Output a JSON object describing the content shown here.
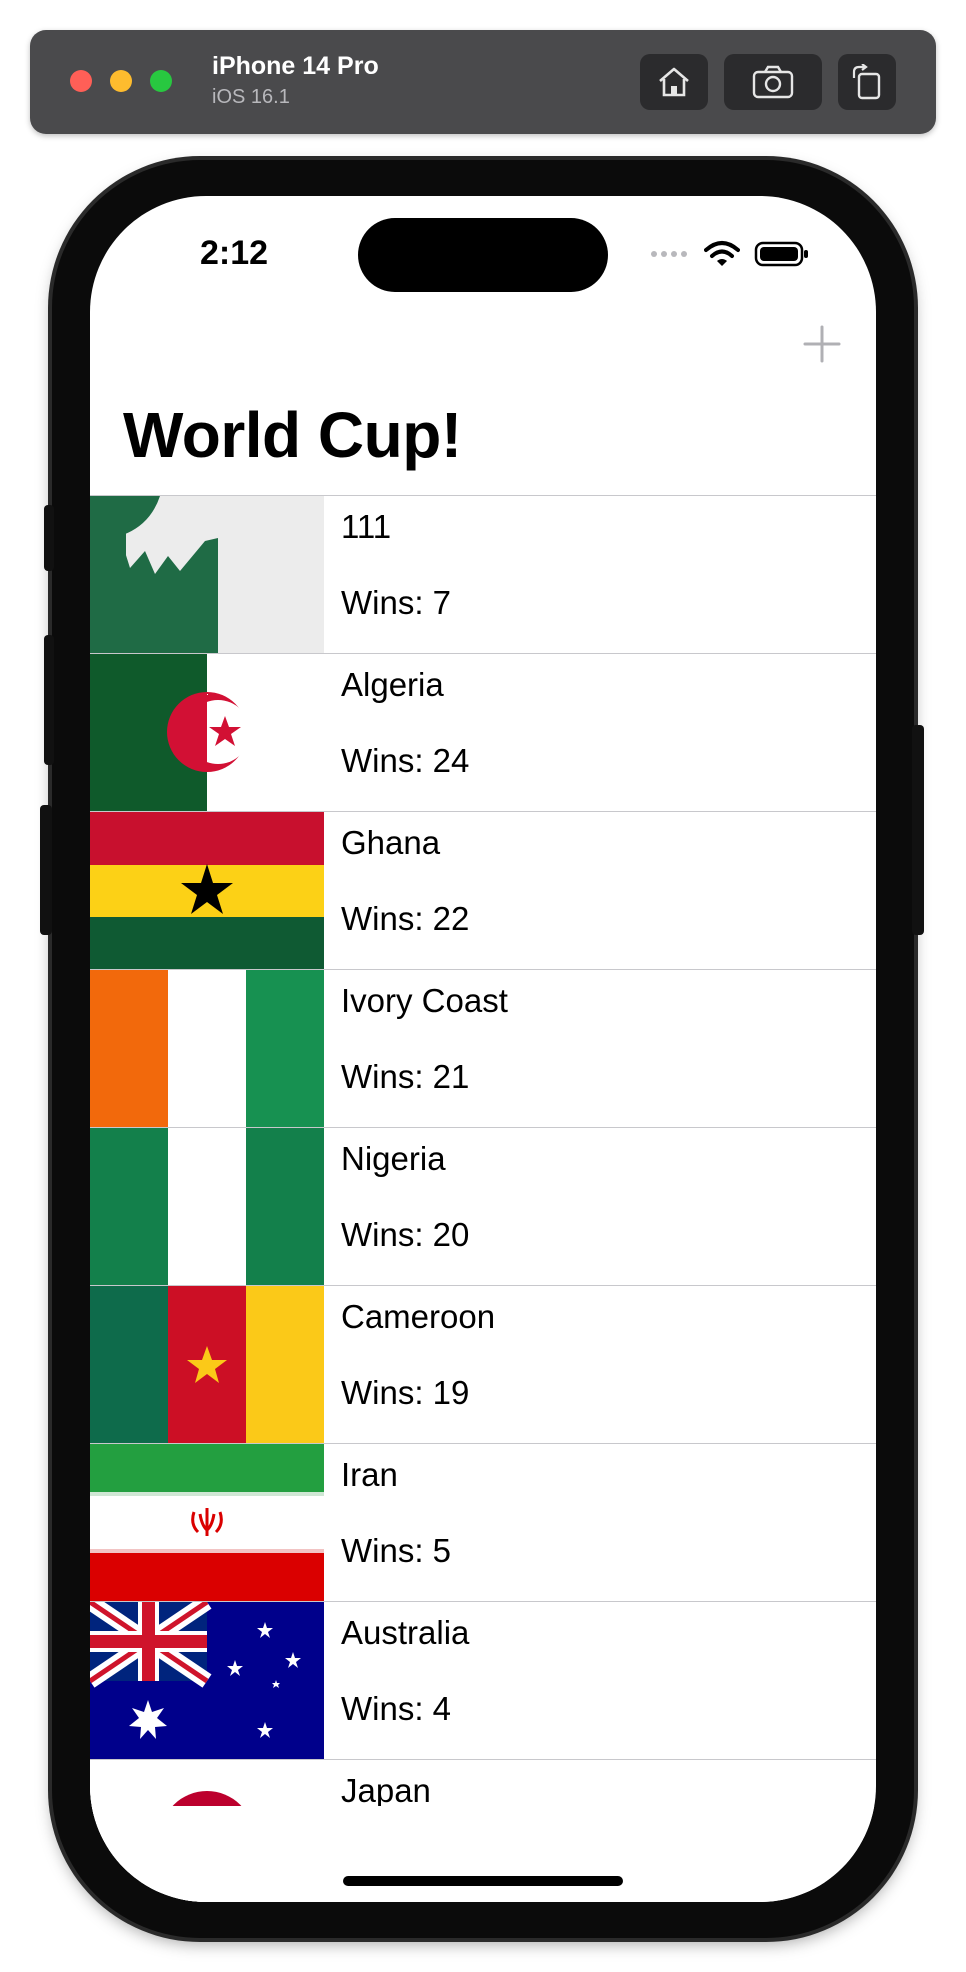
{
  "simulator": {
    "device_name": "iPhone 14 Pro",
    "os_version": "iOS 16.1",
    "icons": [
      "home-icon",
      "screenshot-icon",
      "rotate-icon"
    ]
  },
  "status_bar": {
    "time": "2:12",
    "icons": [
      "signal-icon",
      "wifi-icon",
      "battery-icon"
    ]
  },
  "nav": {
    "title": "World Cup!",
    "add_icon": "plus-icon"
  },
  "teams": [
    {
      "name": "111",
      "wins": "Wins: 7",
      "flag": "placeholder"
    },
    {
      "name": "Algeria",
      "wins": "Wins: 24",
      "flag": "algeria"
    },
    {
      "name": "Ghana",
      "wins": "Wins: 22",
      "flag": "ghana"
    },
    {
      "name": "Ivory Coast",
      "wins": "Wins: 21",
      "flag": "ivory-coast"
    },
    {
      "name": "Nigeria",
      "wins": "Wins: 20",
      "flag": "nigeria"
    },
    {
      "name": "Cameroon",
      "wins": "Wins: 19",
      "flag": "cameroon"
    },
    {
      "name": "Iran",
      "wins": "Wins: 5",
      "flag": "iran"
    },
    {
      "name": "Australia",
      "wins": "Wins: 4",
      "flag": "australia"
    },
    {
      "name": "Japan",
      "wins": "",
      "flag": "japan"
    }
  ],
  "colors": {
    "simulator_bar": "#4a4a4c",
    "separator": "#c8c8cc",
    "add_button": "#b0b0b4"
  }
}
